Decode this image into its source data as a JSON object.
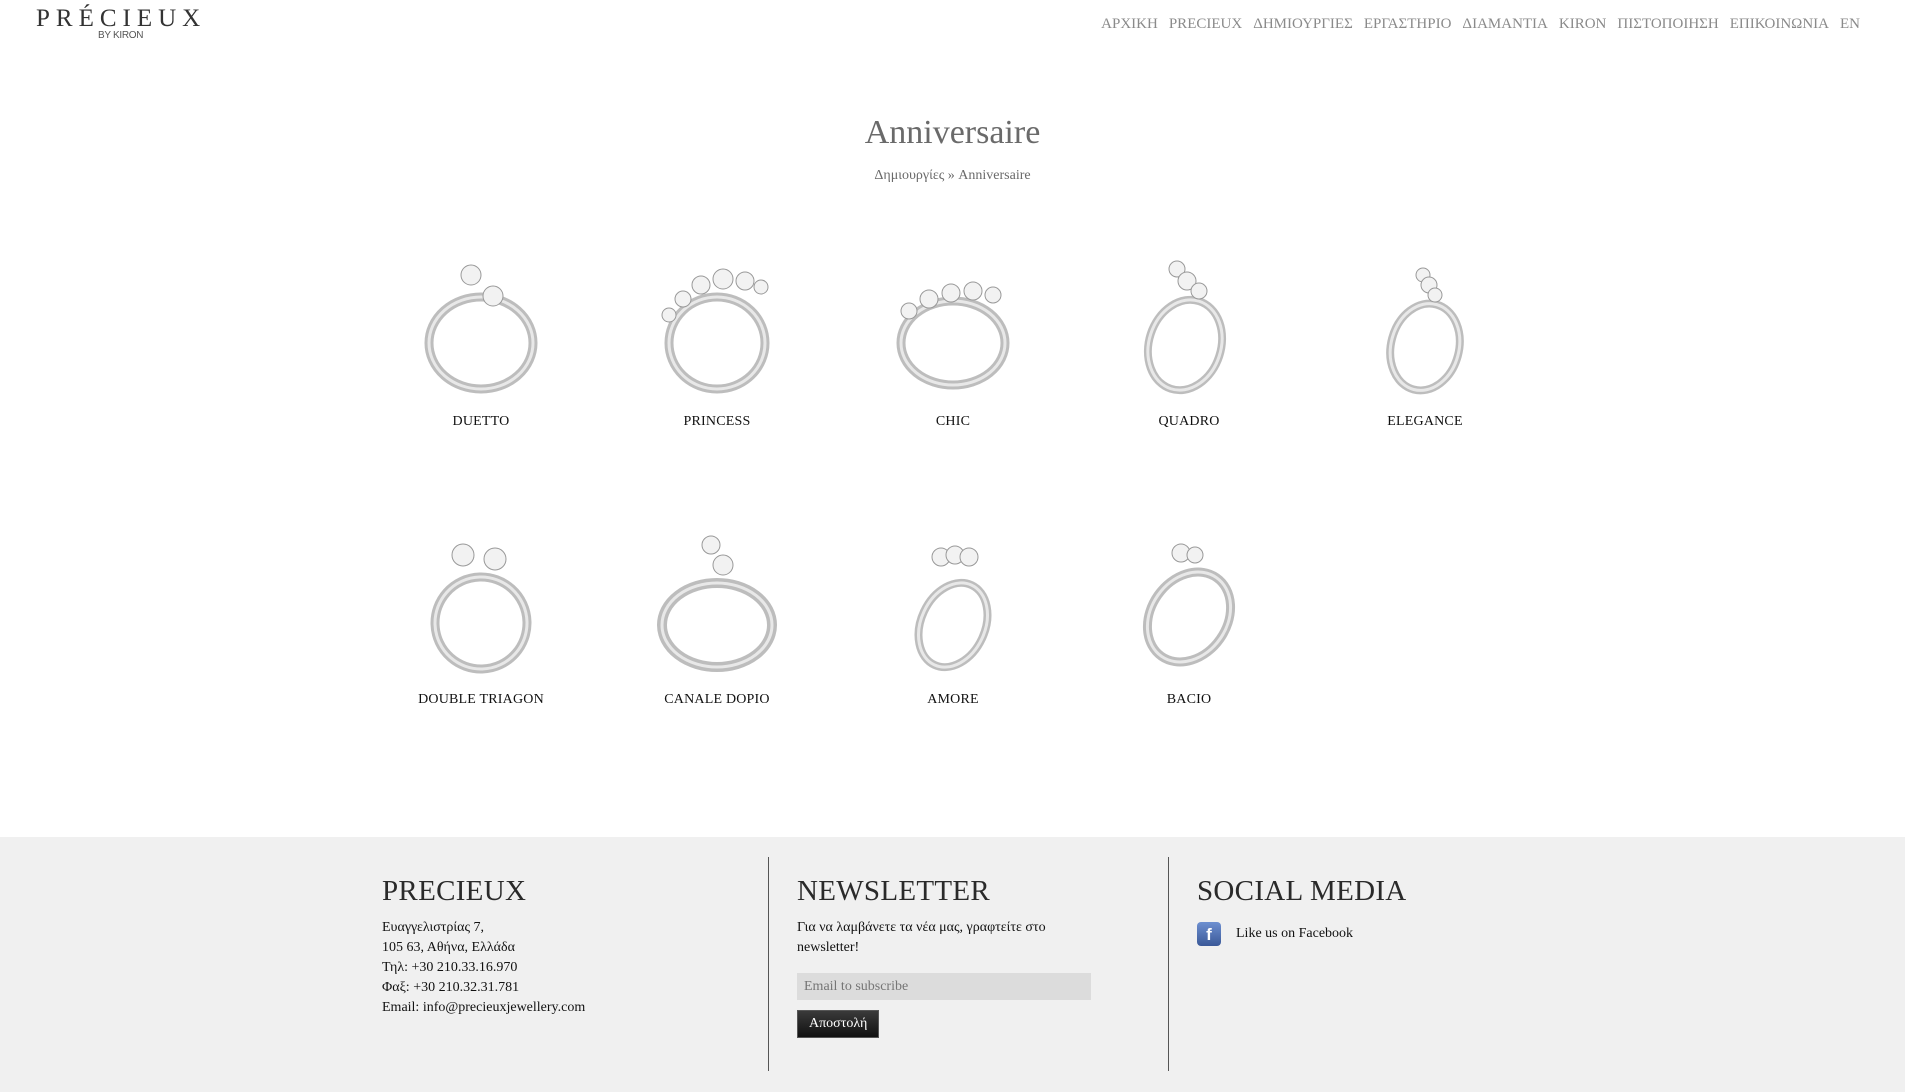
{
  "header": {
    "logo_text": "PRÉCIEUX",
    "logo_sub": "BY KIRON",
    "nav": [
      "ΑΡΧΙΚΗ",
      "PRECIEUX",
      "ΔΗΜΙΟΥΡΓΙΕΣ",
      "ΕΡΓΑΣΤΗΡΙΟ",
      "ΔΙΑΜΑΝΤΙΑ",
      "KIRON",
      "ΠΙΣΤΟΠΟΙΗΣΗ",
      "ΕΠΙΚΟΙΝΩΝΙΑ",
      "EN"
    ]
  },
  "page": {
    "title": "Anniversaire",
    "breadcrumb_parent": "Δημιουργίες",
    "breadcrumb_sep": " » ",
    "breadcrumb_current": "Anniversaire"
  },
  "products": [
    {
      "name": "DUETTO",
      "icon": "ring-two-stone-icon"
    },
    {
      "name": "PRINCESS",
      "icon": "ring-eternity-icon"
    },
    {
      "name": "CHIC",
      "icon": "ring-eternity-icon"
    },
    {
      "name": "QUADRO",
      "icon": "ring-three-stone-icon"
    },
    {
      "name": "ELEGANCE",
      "icon": "ring-three-stone-icon"
    },
    {
      "name": "DOUBLE TRIAGON",
      "icon": "ring-two-stone-icon"
    },
    {
      "name": "CANALE DOPIO",
      "icon": "ring-two-stone-icon"
    },
    {
      "name": "AMORE",
      "icon": "ring-three-stone-icon"
    },
    {
      "name": "BACIO",
      "icon": "ring-two-stone-icon"
    }
  ],
  "footer": {
    "about_title": "PRECIEUX",
    "address1": "Ευαγγελιστρίας 7,",
    "address2": "105 63, Αθήνα, Ελλάδα",
    "phone": "Τηλ: +30 210.33.16.970",
    "fax": "Φαξ: +30 210.32.31.781",
    "email": "Email: info@precieuxjewellery.com",
    "newsletter_title": "NEWSLETTER",
    "newsletter_text": "Για να λαμβάνετε τα νέα μας, γραφτείτε στο newsletter!",
    "email_placeholder": "Email to subscribe",
    "send_label": "Αποστολή",
    "social_title": "SOCIAL MEDIA",
    "facebook_label": "Like us on Facebook"
  },
  "colors": {
    "nav_text": "#8a8a8a",
    "footer_bg": "#f0f0f0",
    "facebook": "#3b5998"
  }
}
